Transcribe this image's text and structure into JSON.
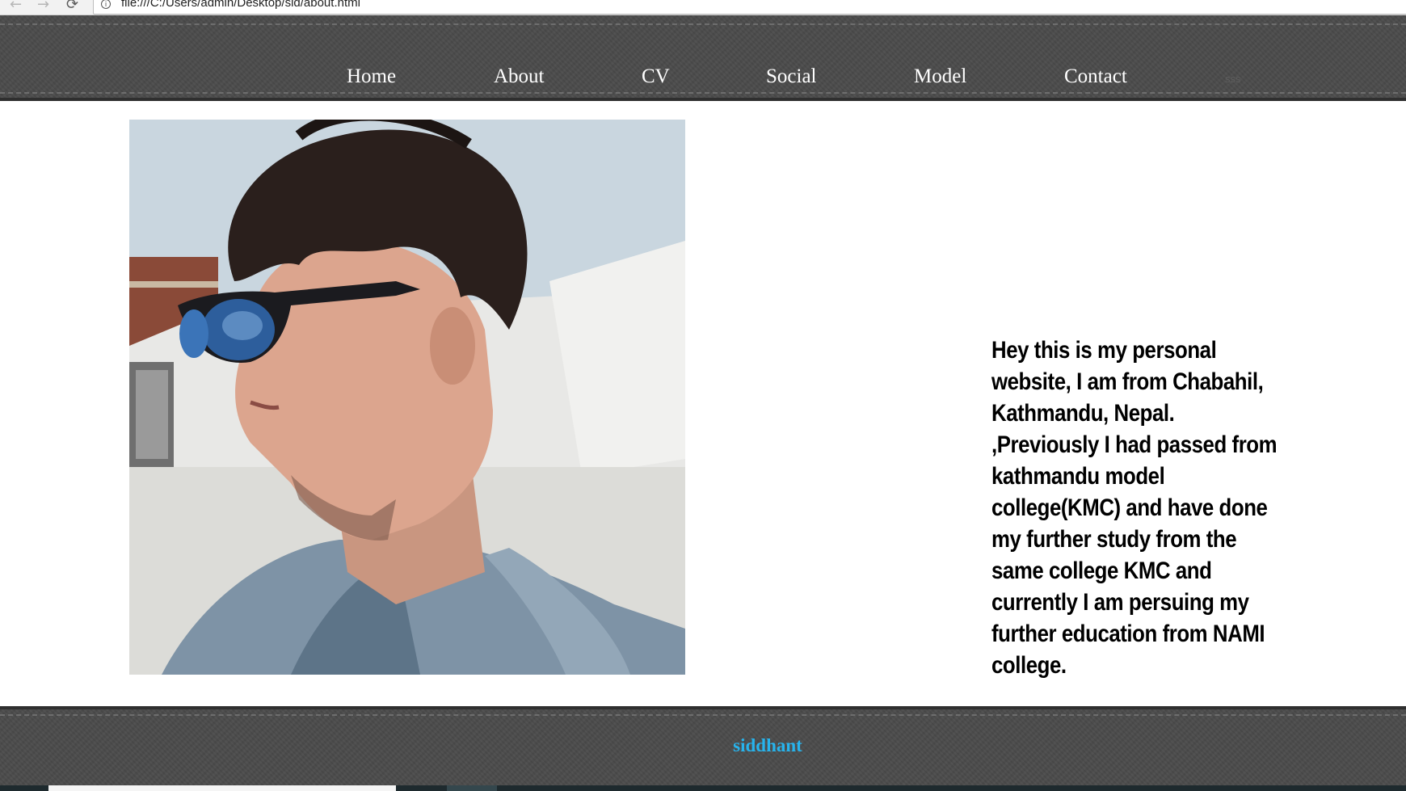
{
  "browser": {
    "back_icon": "arrow-left-icon",
    "forward_icon": "arrow-right-icon",
    "reload_icon": "reload-icon",
    "info_icon": "info-icon",
    "url": "file:///C:/Users/admin/Desktop/sid/about.html"
  },
  "nav": {
    "items": [
      {
        "label": "Home"
      },
      {
        "label": "About"
      },
      {
        "label": "CV"
      },
      {
        "label": "Social"
      },
      {
        "label": "Model"
      },
      {
        "label": "Contact"
      }
    ],
    "extra": "sss"
  },
  "main": {
    "photo_icon": "profile-photo",
    "bio": "Hey this is my personal website, I am from Chabahil, Kathmandu, Nepal. ,Previously I had passed from kathmandu model college(KMC) and have done my further study from the same college KMC and currently I am persuing my further education from NAMI college."
  },
  "footer": {
    "name": "siddhant",
    "name_color": "#27b3ec"
  },
  "colors": {
    "header_bg": "#4b4b4b",
    "nav_text": "#ffffff",
    "body_bg": "#ffffff"
  }
}
